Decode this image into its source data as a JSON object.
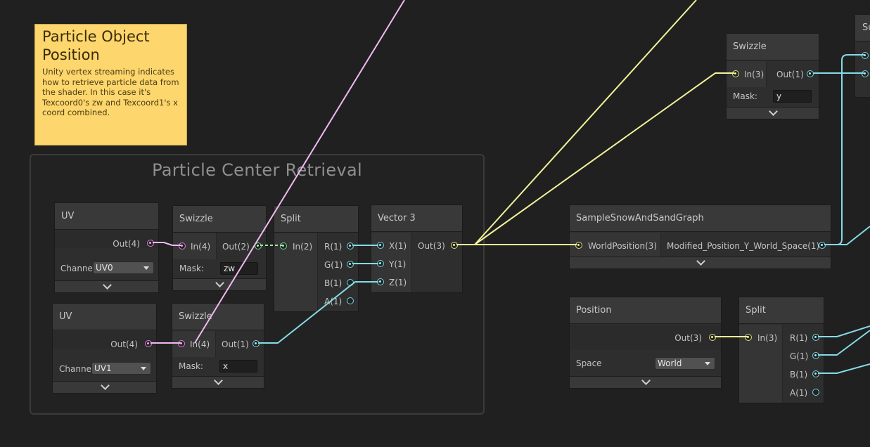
{
  "sticky_note": {
    "title": "Particle Object Position",
    "body": "Unity vertex streaming indicates how to retrieve particle data from the shader. In this case it's Texcoord0's zw and Texcoord1's x coord combined."
  },
  "group": {
    "title": "Particle Center Retrieval"
  },
  "nodes": {
    "uv_a": {
      "title": "UV",
      "out": "Out(4)",
      "channel_label": "Channe",
      "channel_value": "UV0"
    },
    "uv_b": {
      "title": "UV",
      "out": "Out(4)",
      "channel_label": "Channe",
      "channel_value": "UV1"
    },
    "swizzle_a": {
      "title": "Swizzle",
      "in": "In(4)",
      "out": "Out(2)",
      "mask_label": "Mask:",
      "mask_value": "zw"
    },
    "swizzle_b": {
      "title": "Swizzle",
      "in": "In(4)",
      "out": "Out(1)",
      "mask_label": "Mask:",
      "mask_value": "x"
    },
    "split_a": {
      "title": "Split",
      "in": "In(2)",
      "outs": [
        "R(1)",
        "G(1)",
        "B(1)",
        "A(1)"
      ]
    },
    "vector3": {
      "title": "Vector 3",
      "ins": [
        "X(1)",
        "Y(1)",
        "Z(1)"
      ],
      "out": "Out(3)"
    },
    "swizzle_top": {
      "title": "Swizzle",
      "in": "In(3)",
      "out": "Out(1)",
      "mask_label": "Mask:",
      "mask_value": "y"
    },
    "subgraph_partial": {
      "title": "Su"
    },
    "sample_snow": {
      "title": "SampleSnowAndSandGraph",
      "in": "WorldPosition(3)",
      "out": "Modified_Position_Y_World_Space(1)"
    },
    "position": {
      "title": "Position",
      "out": "Out(3)",
      "space_label": "Space",
      "space_value": "World"
    },
    "split_b": {
      "title": "Split",
      "in": "In(3)",
      "outs": [
        "R(1)",
        "G(1)",
        "B(1)",
        "A(1)"
      ]
    }
  },
  "colors": {
    "background": "#202020",
    "node_body": "#2e2e2e",
    "node_header": "#393939",
    "sticky_note": "#fdd66e",
    "wire_vector4": "#f0b4f0",
    "wire_vector3": "#f2f29a",
    "wire_vector2": "#9be8a8",
    "wire_float": "#84dbe6"
  }
}
